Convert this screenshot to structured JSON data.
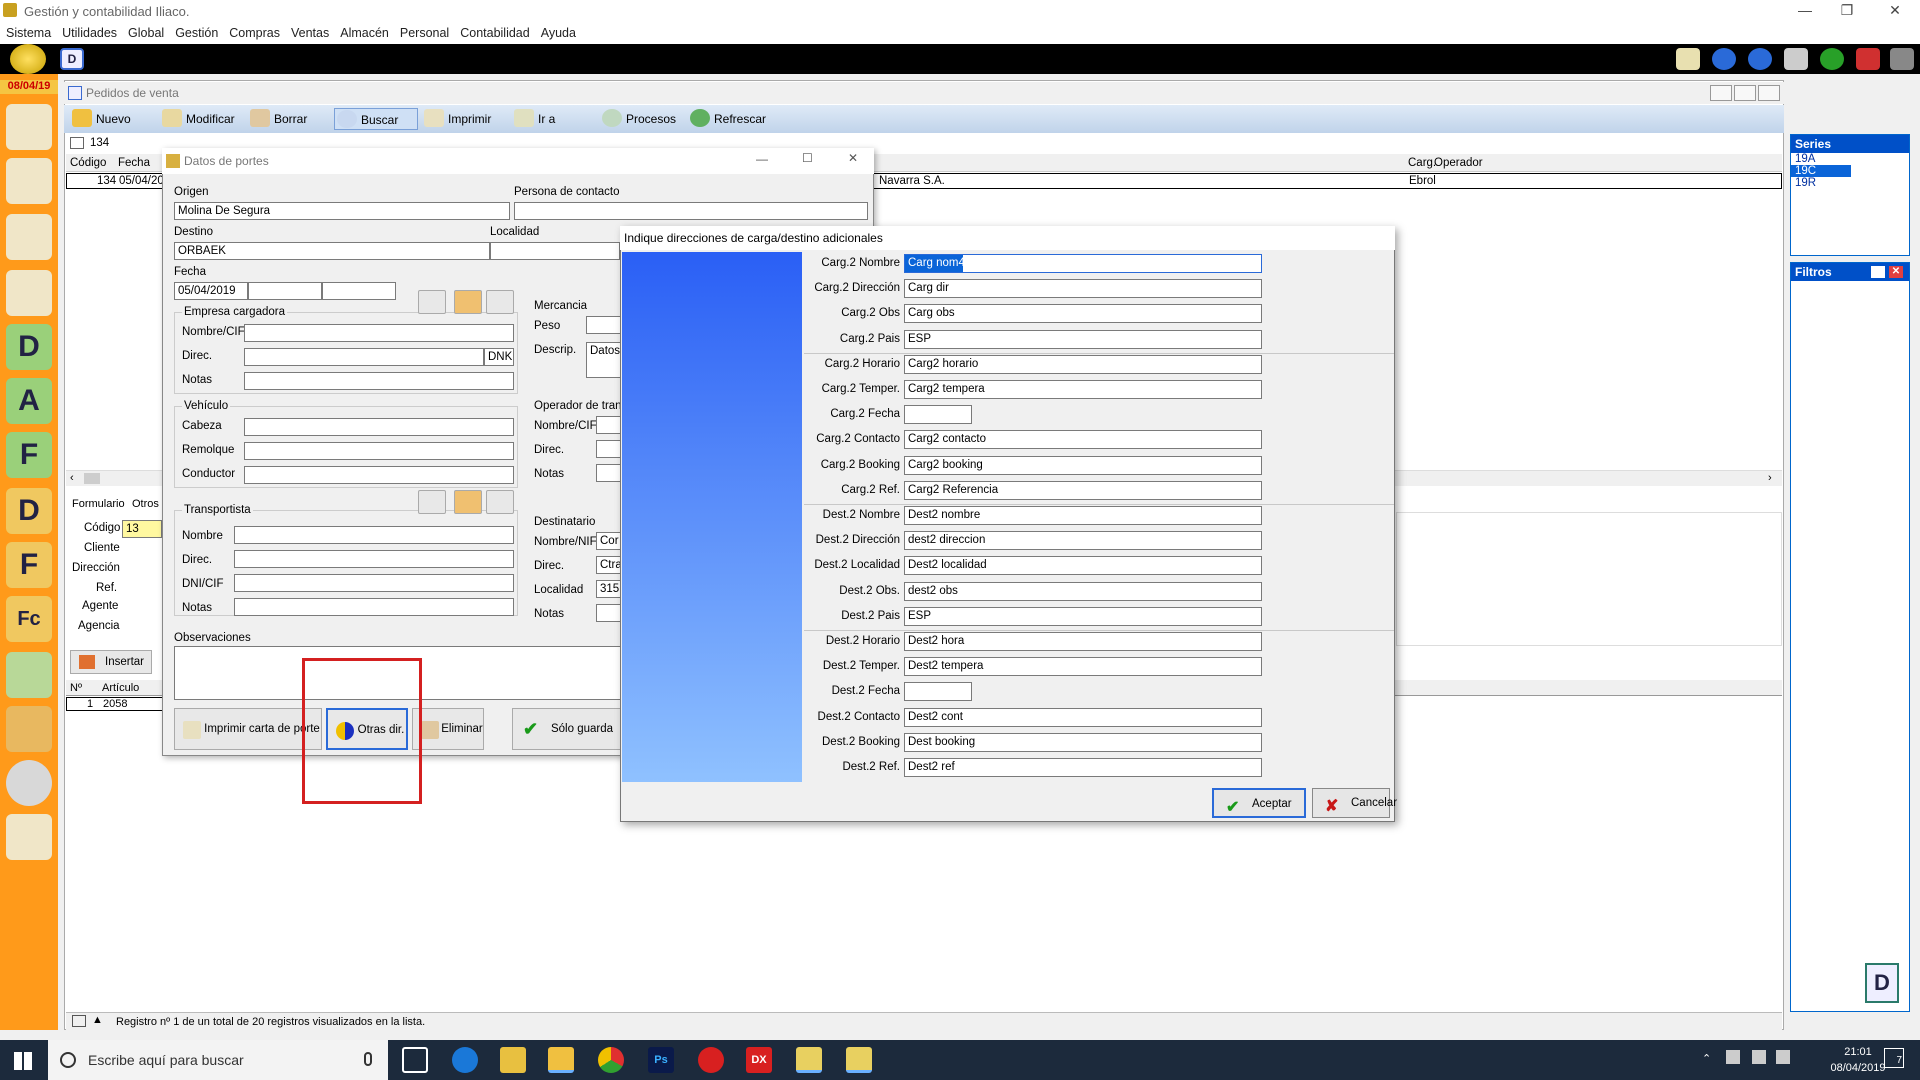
{
  "app": {
    "title": "Gestión y contabilidad Iliaco.",
    "menu": [
      "Sistema",
      "Utilidades",
      "Global",
      "Gestión",
      "Compras",
      "Ventas",
      "Almacén",
      "Personal",
      "Contabilidad",
      "Ayuda"
    ],
    "date_badge": "08/04/19",
    "leftbar_letters": [
      "D",
      "A",
      "F",
      "D",
      "F",
      "Fc"
    ]
  },
  "main": {
    "title": "Pedidos de venta",
    "toolbar": [
      "Nuevo",
      "Modificar",
      "Borrar",
      "Buscar",
      "Imprimir",
      "Ir a",
      "Procesos",
      "Refrescar"
    ],
    "record_no": "134",
    "grid_headers": [
      "Código",
      "Fecha",
      "Carg.",
      "Operador"
    ],
    "grid_row": {
      "codigo": "134",
      "fecha": "05/04/20",
      "cliente": "Navarra S.A.",
      "operador": "Ebrol"
    },
    "series_title": "Series",
    "series": [
      "19A",
      "19C",
      "19R"
    ],
    "filtros_title": "Filtros",
    "tabs": [
      "Formulario",
      "Otros"
    ],
    "form_labels": [
      "Código",
      "Cliente",
      "Dirección",
      "Ref.",
      "Agente",
      "Agencia"
    ],
    "form_codigo": "13",
    "insert_btn": "Insertar",
    "lines_headers": [
      "Nº",
      "Artículo"
    ],
    "lines_row": {
      "n": "1",
      "articulo": "2058"
    },
    "status": "Registro nº 1 de un total de 20 registros visualizados en la lista."
  },
  "portes": {
    "title": "Datos de portes",
    "origen_label": "Origen",
    "origen": "Molina De Segura",
    "contacto_label": "Persona de contacto",
    "destino_label": "Destino",
    "destino": "ORBAEK",
    "localidad_label": "Localidad",
    "fecha_label": "Fecha",
    "fecha": "05/04/2019",
    "empresa_label": "Empresa cargadora",
    "nombre_cif_label": "Nombre/CIF",
    "direc_label": "Direc.",
    "direc_suffix": "DNK",
    "notas_label": "Notas",
    "vehiculo_label": "Vehículo",
    "cabeza_label": "Cabeza",
    "remolque_label": "Remolque",
    "conductor_label": "Conductor",
    "transportista_label": "Transportista",
    "nombre_label": "Nombre",
    "dni_label": "DNI/CIF",
    "observaciones_label": "Observaciones",
    "mercancia_label": "Mercancia",
    "peso_label": "Peso",
    "descrip_label": "Descrip.",
    "descrip": "Datos",
    "operador_label": "Operador de transp",
    "destinatario_label": "Destinatario",
    "nombre_nif_label": "Nombre/NIF",
    "dest_nombre": "Cor",
    "dest_direc": "Ctra.",
    "dest_localidad_label": "Localidad",
    "dest_localidad": "315",
    "btn_imprimir": "Imprimir carta de porte",
    "btn_otras": "Otras dir.",
    "btn_eliminar": "Eliminar",
    "btn_solo": "Sólo guarda"
  },
  "dir": {
    "title": "Indique direcciones de carga/destino adicionales",
    "rows": [
      {
        "label": "Carg.2 Nombre",
        "value": "Carg nom4",
        "short": false
      },
      {
        "label": "Carg.2 Dirección",
        "value": "Carg dir",
        "short": false
      },
      {
        "label": "Carg.2 Obs",
        "value": "Carg obs",
        "short": false
      },
      {
        "label": "Carg.2 Pais",
        "value": "ESP",
        "short": false
      },
      {
        "label": "Carg.2 Horario",
        "value": "Carg2 horario",
        "short": false
      },
      {
        "label": "Carg.2 Temper.",
        "value": "Carg2 tempera",
        "short": false
      },
      {
        "label": "Carg.2 Fecha",
        "value": "",
        "short": true
      },
      {
        "label": "Carg.2 Contacto",
        "value": "Carg2 contacto",
        "short": false
      },
      {
        "label": "Carg.2 Booking",
        "value": "Carg2 booking",
        "short": false
      },
      {
        "label": "Carg.2 Ref.",
        "value": "Carg2 Referencia",
        "short": false
      },
      {
        "label": "Dest.2 Nombre",
        "value": "Dest2 nombre",
        "short": false
      },
      {
        "label": "Dest.2 Dirección",
        "value": "dest2 direccion",
        "short": false
      },
      {
        "label": "Dest.2 Localidad",
        "value": "Dest2 localidad",
        "short": false
      },
      {
        "label": "Dest.2 Obs.",
        "value": "dest2 obs",
        "short": false
      },
      {
        "label": "Dest.2 Pais",
        "value": "ESP",
        "short": false
      },
      {
        "label": "Dest.2 Horario",
        "value": "Dest2 hora",
        "short": false
      },
      {
        "label": "Dest.2 Temper.",
        "value": "Dest2 tempera",
        "short": false
      },
      {
        "label": "Dest.2 Fecha",
        "value": "",
        "short": true
      },
      {
        "label": "Dest.2 Contacto",
        "value": "Dest2 cont",
        "short": false
      },
      {
        "label": "Dest.2 Booking",
        "value": "Dest booking",
        "short": false
      },
      {
        "label": "Dest.2 Ref.",
        "value": "Dest2 ref",
        "short": false
      }
    ],
    "btn_aceptar": "Aceptar",
    "btn_cancelar": "Cancelar"
  },
  "taskbar": {
    "search_placeholder": "Escribe aquí para buscar",
    "time": "21:01",
    "date": "08/04/2019",
    "notif_count": "7"
  }
}
